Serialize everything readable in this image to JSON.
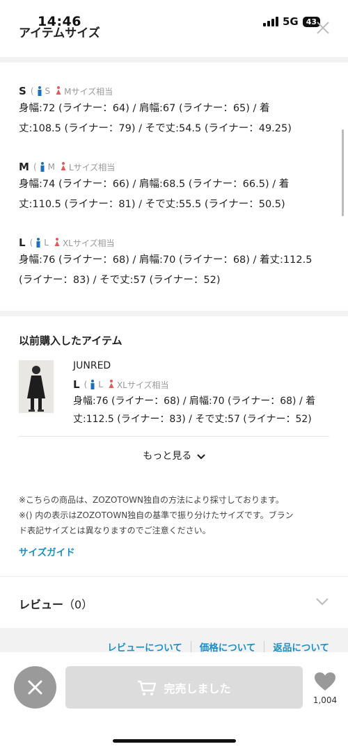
{
  "status": {
    "time": "14:46",
    "network": "5G",
    "battery": "43"
  },
  "header": {
    "title": "アイテムサイズ"
  },
  "sizes": [
    {
      "code": "S",
      "men": "S",
      "women": "Mサイズ相当",
      "line1": "身幅:72 (ライナー：64) / 肩幅:67 (ライナー：65) / 着",
      "line2": "丈:108.5 (ライナー：79) / そで丈:54.5 (ライナー：49.25)"
    },
    {
      "code": "M",
      "men": "M",
      "women": "Lサイズ相当",
      "line1": "身幅:74 (ライナー：66) / 肩幅:68.5 (ライナー：66.5) / 着",
      "line2": "丈:110.5 (ライナー：81) / そで丈:55.5 (ライナー：50.5)"
    },
    {
      "code": "L",
      "men": "L",
      "women": "XLサイズ相当",
      "line1": "身幅:76 (ライナー：68) / 肩幅:70 (ライナー：68) / 着丈:112.5",
      "line2": "(ライナー：83) / そで丈:57 (ライナー：52)"
    }
  ],
  "previous": {
    "title": "以前購入したアイテム",
    "brand": "JUNRED",
    "size_code": "L",
    "men": "L",
    "women": "XLサイズ相当",
    "line1": "身幅:76 (ライナー：68) / 肩幅:70 (ライナー：68) / 着",
    "line2": "丈:112.5 (ライナー：83) / そで丈:57 (ライナー：52)",
    "more_label": "もっと見る",
    "note1": "※こちらの商品は、ZOZOTOWN独自の方法により採寸しております。",
    "note2a": "※() 内の表示はZOZOTOWN独自の基準で振り分けたサイズです。ブラン",
    "note2b": "ド表記サイズとは異なりますのでご注意ください。",
    "guide_label": "サイズガイド"
  },
  "review": {
    "label": "レビュー",
    "count": "（0）"
  },
  "links": {
    "review": "レビューについて",
    "price": "価格について",
    "return": "返品について"
  },
  "bottom": {
    "sold_label": "完売しました",
    "fav_count": "1,004"
  },
  "colors": {
    "accent": "#1a8fc9",
    "men_icon": "#1a6fc0",
    "women_icon": "#e05b5b"
  }
}
